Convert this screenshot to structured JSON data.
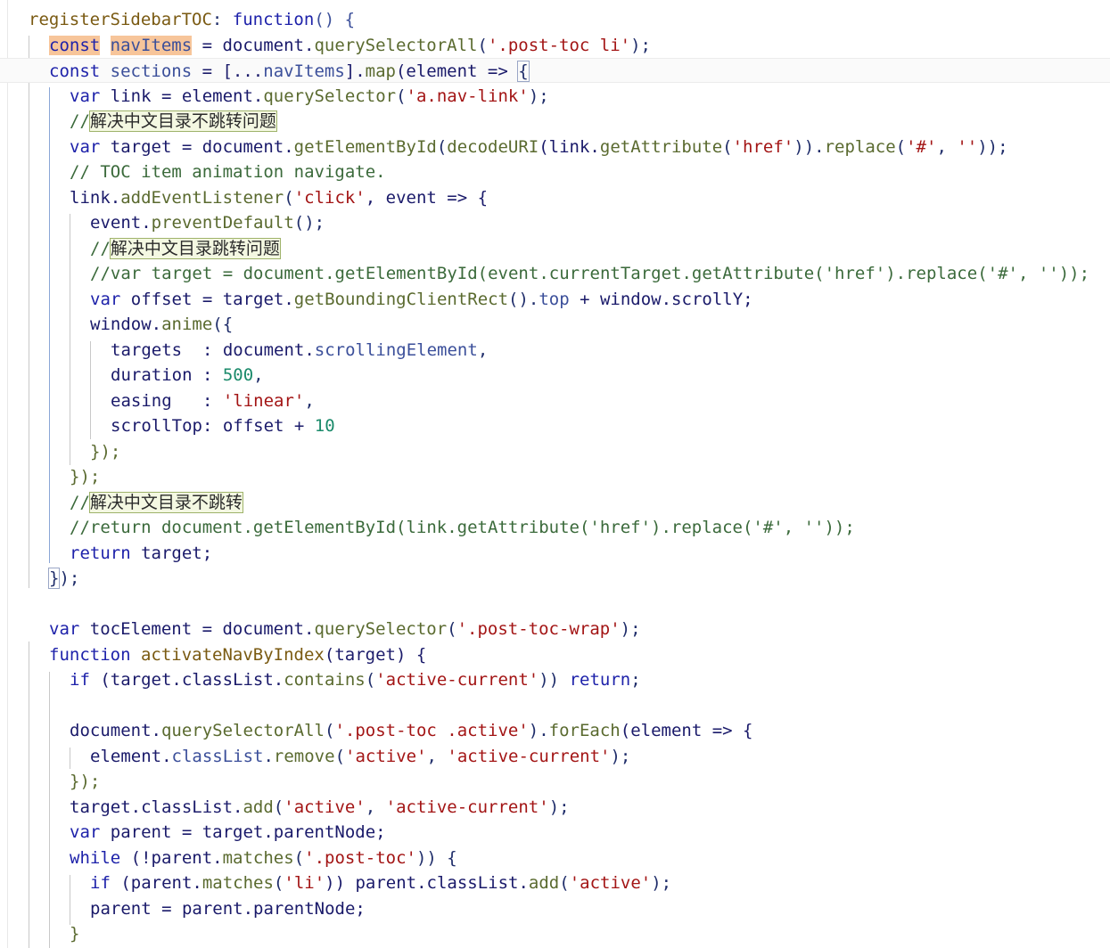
{
  "editor": {
    "lines": [
      [
        "registerSidebarTOC",
        ": ",
        "function",
        "() {"
      ],
      [
        "const",
        " ",
        "navItems",
        " = document.",
        "querySelectorAll",
        "(",
        "'.post-toc li'",
        ");"
      ],
      [
        "const",
        " ",
        "sections",
        " = [...",
        "navItems",
        "].",
        "map",
        "(element => ",
        "{"
      ],
      [
        "var",
        " link = element.",
        "querySelector",
        "(",
        "'a.nav-link'",
        ");"
      ],
      [
        "//",
        "解决中文目录不跳转问题"
      ],
      [
        "var",
        " target = document.",
        "getElementById",
        "(",
        "decodeURI",
        "(link.",
        "getAttribute",
        "(",
        "'href'",
        ")).",
        "replace",
        "(",
        "'#'",
        ", ",
        "''",
        "));"
      ],
      [
        "// TOC item animation navigate."
      ],
      [
        "link.",
        "addEventListener",
        "(",
        "'click'",
        ", event => {"
      ],
      [
        "event.",
        "preventDefault",
        "();"
      ],
      [
        "//",
        "解决中文目录跳转问题"
      ],
      [
        "//var target = document.getElementById(event.currentTarget.getAttribute('href').replace('#', ''));"
      ],
      [
        "var",
        " offset = target.",
        "getBoundingClientRect",
        "().",
        "top",
        " + window.scrollY;"
      ],
      [
        "window.",
        "anime",
        "({"
      ],
      [
        "targets  : document.",
        "scrollingElement",
        ","
      ],
      [
        "duration : ",
        "500",
        ","
      ],
      [
        "easing   : ",
        "'linear'",
        ","
      ],
      [
        "scrollTop: offset + ",
        "10"
      ],
      [
        "});"
      ],
      [
        "});"
      ],
      [
        "//",
        "解决中文目录不跳转"
      ],
      [
        "//return document.getElementById(link.getAttribute('href').replace('#', ''));"
      ],
      [
        "return",
        " target;"
      ],
      [
        "}",
        ");"
      ],
      [
        ""
      ],
      [
        "var",
        " tocElement = document.",
        "querySelector",
        "(",
        "'.post-toc-wrap'",
        ");"
      ],
      [
        "function",
        " ",
        "activateNavByIndex",
        "(target) {"
      ],
      [
        "if",
        " (target.classList.",
        "contains",
        "(",
        "'active-current'",
        ")) ",
        "return",
        ";"
      ],
      [
        ""
      ],
      [
        "document.",
        "querySelectorAll",
        "(",
        "'.post-toc .active'",
        ").",
        "forEach",
        "(element => {"
      ],
      [
        "element.",
        "classList",
        ".",
        "remove",
        "(",
        "'active'",
        ", ",
        "'active-current'",
        ");"
      ],
      [
        "});"
      ],
      [
        "target.classList.",
        "add",
        "(",
        "'active'",
        ", ",
        "'active-current'",
        ");"
      ],
      [
        "var",
        " parent = target.parentNode;"
      ],
      [
        "while",
        " (!parent.",
        "matches",
        "(",
        "'.post-toc'",
        ")) {"
      ],
      [
        "if",
        " (parent.",
        "matches",
        "(",
        "'li'",
        ")) parent.classList.",
        "add",
        "(",
        "'active'",
        ");"
      ],
      [
        "parent = parent.parentNode;"
      ],
      [
        "}"
      ]
    ]
  }
}
